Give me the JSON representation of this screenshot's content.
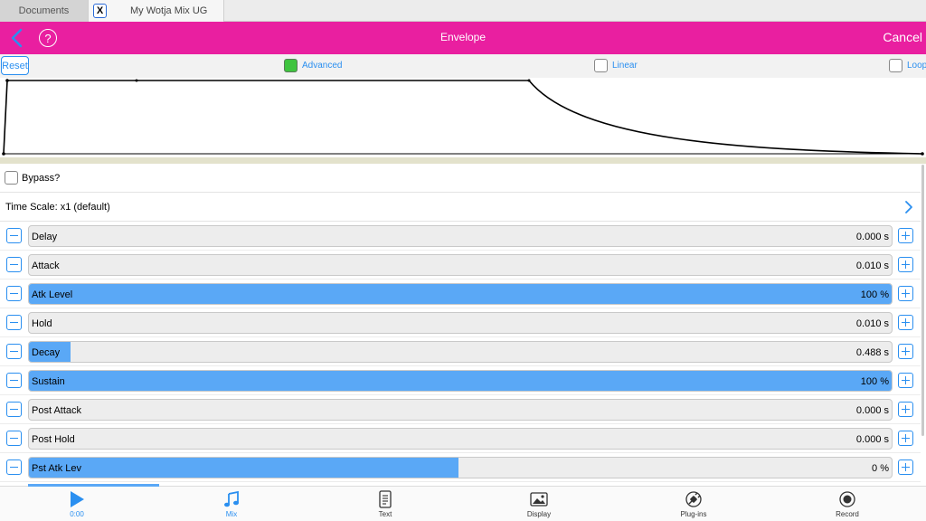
{
  "tabs": {
    "documents": "Documents",
    "close": "X",
    "active_title": "My Wotja Mix UG"
  },
  "header": {
    "title": "Envelope",
    "cancel": "Cancel",
    "help": "?"
  },
  "toolbar": {
    "reset": "Reset",
    "advanced": {
      "label": "Advanced",
      "checked": true
    },
    "linear": {
      "label": "Linear",
      "checked": false
    },
    "loop": {
      "label": "Loop",
      "checked": false
    }
  },
  "bypass": {
    "label": "Bypass?",
    "checked": false
  },
  "time_scale": {
    "label": "Time Scale: x1 (default)"
  },
  "params": [
    {
      "label": "Delay",
      "value": "0.000 s",
      "fill": 0
    },
    {
      "label": "Attack",
      "value": "0.010 s",
      "fill": 0
    },
    {
      "label": "Atk Level",
      "value": "100 %",
      "fill": 1.0
    },
    {
      "label": "Hold",
      "value": "0.010 s",
      "fill": 0
    },
    {
      "label": "Decay",
      "value": "0.488 s",
      "fill": 0.048
    },
    {
      "label": "Sustain",
      "value": "100 %",
      "fill": 1.0
    },
    {
      "label": "Post Attack",
      "value": "0.000 s",
      "fill": 0
    },
    {
      "label": "Post Hold",
      "value": "0.000 s",
      "fill": 0
    },
    {
      "label": "Pst Atk Lev",
      "value": "0 %",
      "fill": 0.498
    }
  ],
  "bottom_tabs": [
    {
      "label": "0:00",
      "icon": "play-icon",
      "active": true
    },
    {
      "label": "Mix",
      "icon": "music-note-icon",
      "active": true
    },
    {
      "label": "Text",
      "icon": "document-icon",
      "active": false
    },
    {
      "label": "Display",
      "icon": "image-icon",
      "active": false
    },
    {
      "label": "Plug-ins",
      "icon": "plug-icon",
      "active": false
    },
    {
      "label": "Record",
      "icon": "record-icon",
      "active": false
    }
  ],
  "colors": {
    "accent": "#e91fa0",
    "link": "#2a8ff0",
    "slider_fill": "#5aa8f6",
    "checked": "#3fc43f"
  }
}
